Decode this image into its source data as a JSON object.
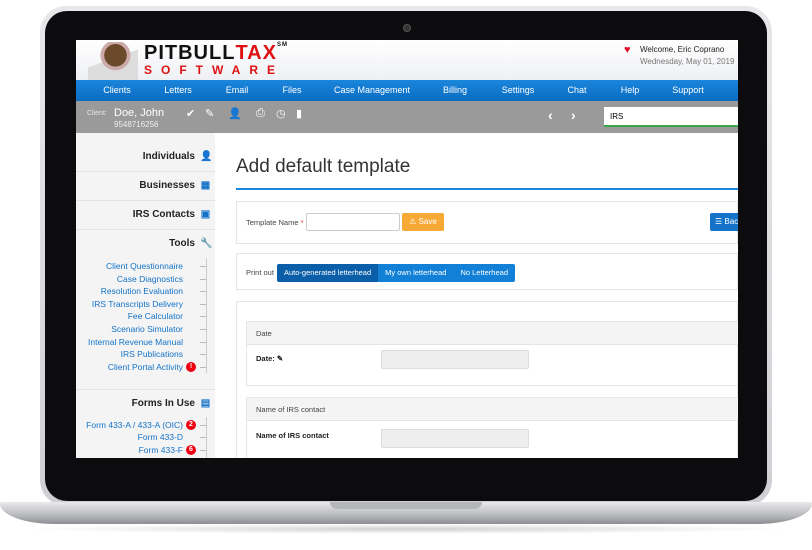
{
  "header": {
    "logo_line1": "PITBULL",
    "logo_line1_red": "TAX",
    "logo_tm": "SM",
    "logo_line2": "SOFTWARE",
    "welcome": "Welcome, Eric Coprano",
    "date": "Wednesday, May 01, 2019"
  },
  "nav": [
    "Clients",
    "Letters",
    "Email",
    "Files",
    "Case Management",
    "Billing",
    "Settings",
    "Chat",
    "Help",
    "Support"
  ],
  "client": {
    "label": "Client:",
    "name": "Doe, John",
    "phone": "9548716256",
    "search_value": "IRS"
  },
  "sidebar": {
    "sections": [
      "Individuals",
      "Businesses",
      "IRS Contacts",
      "Tools",
      "Forms In Use"
    ],
    "tools": [
      "Client Questionnaire",
      "Case Diagnostics",
      "Resolution Evaluation",
      "IRS Transcripts Delivery",
      "Fee Calculator",
      "Scenario Simulator",
      "Internal Revenue Manual",
      "IRS Publications",
      "Client Portal Activity"
    ],
    "tools_alert_badge": "!",
    "forms": [
      {
        "label": "Form 433-A / 433-A (OIC)",
        "badge": "2"
      },
      {
        "label": "Form 433-D",
        "badge": ""
      },
      {
        "label": "Form 433-F",
        "badge": "6"
      }
    ]
  },
  "main": {
    "title": "Add default template",
    "template_name_label": "Template Name",
    "required_mark": "*",
    "template_name_value": "",
    "save_label": "Save",
    "back_label": "Back",
    "print_out_label": "Print out",
    "print_options": [
      "Auto-generated letterhead",
      "My own letterhead",
      "No Letterhead"
    ],
    "print_selected": "Auto-generated letterhead",
    "fields": [
      {
        "header": "Date",
        "label": "Date:"
      },
      {
        "header": "Name of IRS contact",
        "label": "Name of IRS contact"
      }
    ]
  },
  "colors": {
    "nav_blue": "#0a6cc2",
    "client_bar": "#9a9a9a",
    "link_blue": "#1473c8",
    "save_orange": "#f7a935",
    "alert_red": "#e01010"
  }
}
